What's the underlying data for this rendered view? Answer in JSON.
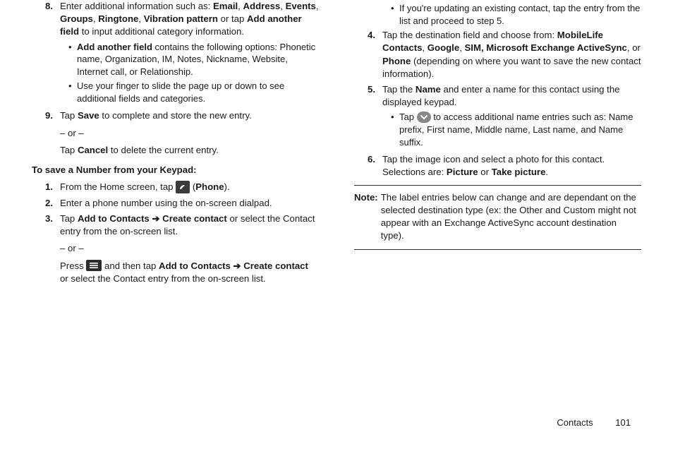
{
  "left": {
    "item8": {
      "num": "8.",
      "text_pre": "Enter additional information such as: ",
      "bold_list": "Email, Address, Events, Groups, Ringtone, Vibration pattern",
      "b1": "Email",
      "c1": ", ",
      "b2": "Address",
      "c2": ", ",
      "b3": "Events",
      "c3": ", ",
      "b4": "Groups",
      "c4": ", ",
      "b5": "Ringtone",
      "c5": ", ",
      "b6": "Vibration pattern",
      "text_mid": " or tap ",
      "b7": "Add another field",
      "text_post": " to input additional category information.",
      "sub1_bold": "Add another field",
      "sub1_rest": " contains the following options: Phonetic name, Organization, IM, Notes, Nickname, Website, Internet call, or Relationship.",
      "sub2": "Use your finger to slide the page up or down to see additional fields and categories."
    },
    "item9": {
      "num": "9.",
      "pre": "Tap ",
      "save": "Save",
      "post": " to complete and store the new entry.",
      "or": "– or –",
      "pre2": "Tap ",
      "cancel": "Cancel",
      "post2": " to delete the current entry."
    },
    "heading": "To save a Number from your Keypad:",
    "k1": {
      "num": "1.",
      "pre": "From the Home screen, tap ",
      "paren_open": " (",
      "phone": "Phone",
      "paren_close": ")."
    },
    "k2": {
      "num": "2.",
      "text": "Enter a phone number using the on-screen dialpad."
    },
    "k3": {
      "num": "3.",
      "pre": "Tap ",
      "b1": "Add to Contacts",
      "arr": " ➔ ",
      "b2": "Create contact",
      "post": " or select the Contact entry from the on-screen list.",
      "or": "– or –",
      "press_pre": "Press ",
      "press_mid": " and then tap ",
      "b3": "Add to Contacts",
      "arr2": " ➔ ",
      "b4": "Create contact",
      "press_post": " or select the Contact entry from the on-screen list."
    }
  },
  "right": {
    "cont_sub": "If you're updating an existing contact, tap the entry from the list and proceed to step 5.",
    "item4": {
      "num": "4.",
      "pre": "Tap the destination field and choose from: ",
      "b1": "MobileLife Contacts",
      "c1": ", ",
      "b2": "Google",
      "c2": ", ",
      "b3": "SIM, Microsoft Exchange ActiveSync",
      "c3": ", or ",
      "b4": "Phone",
      "post": " (depending on where you want to save the new contact information)."
    },
    "item5": {
      "num": "5.",
      "pre": "Tap the ",
      "name": "Name",
      "post": " and enter a name for this contact using the displayed keypad.",
      "sub_pre": "Tap ",
      "sub_post": " to access additional name entries such as: Name prefix, First name, Middle name, Last name, and Name suffix."
    },
    "item6": {
      "num": "6.",
      "pre": "Tap the image icon and select a photo for this contact. Selections are: ",
      "b1": "Picture",
      "mid": " or ",
      "b2": "Take picture",
      "post": "."
    },
    "note": {
      "label": "Note:",
      "text": " The label entries below can change and are dependant on the selected destination type (ex: the Other and Custom might not appear with an Exchange ActiveSync account destination type)."
    }
  },
  "footer": {
    "section": "Contacts",
    "page": "101"
  }
}
